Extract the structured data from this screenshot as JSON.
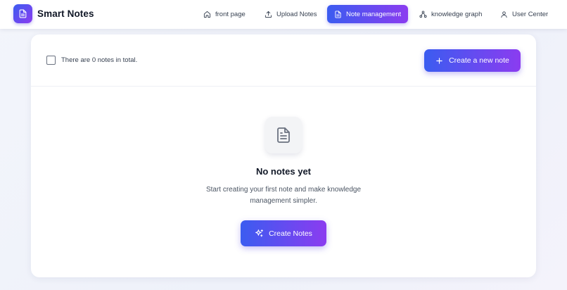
{
  "app": {
    "name": "Smart Notes"
  },
  "nav": {
    "items": [
      {
        "label": "front page",
        "icon": "home-icon"
      },
      {
        "label": "Upload Notes",
        "icon": "upload-icon"
      },
      {
        "label": "Note management",
        "icon": "document-icon",
        "active": true
      },
      {
        "label": "knowledge graph",
        "icon": "network-icon"
      },
      {
        "label": "User Center",
        "icon": "user-icon"
      }
    ]
  },
  "toolbar": {
    "total_text": "There are 0 notes in total.",
    "create_new_label": "Create a new note"
  },
  "empty_state": {
    "icon": "document-icon",
    "title": "No notes yet",
    "description": "Start creating your first note and make knowledge management simpler.",
    "button_label": "Create Notes",
    "button_icon": "sparkles-icon"
  },
  "colors": {
    "accent_start": "#3b5cf0",
    "accent_end": "#8b3cf0"
  }
}
